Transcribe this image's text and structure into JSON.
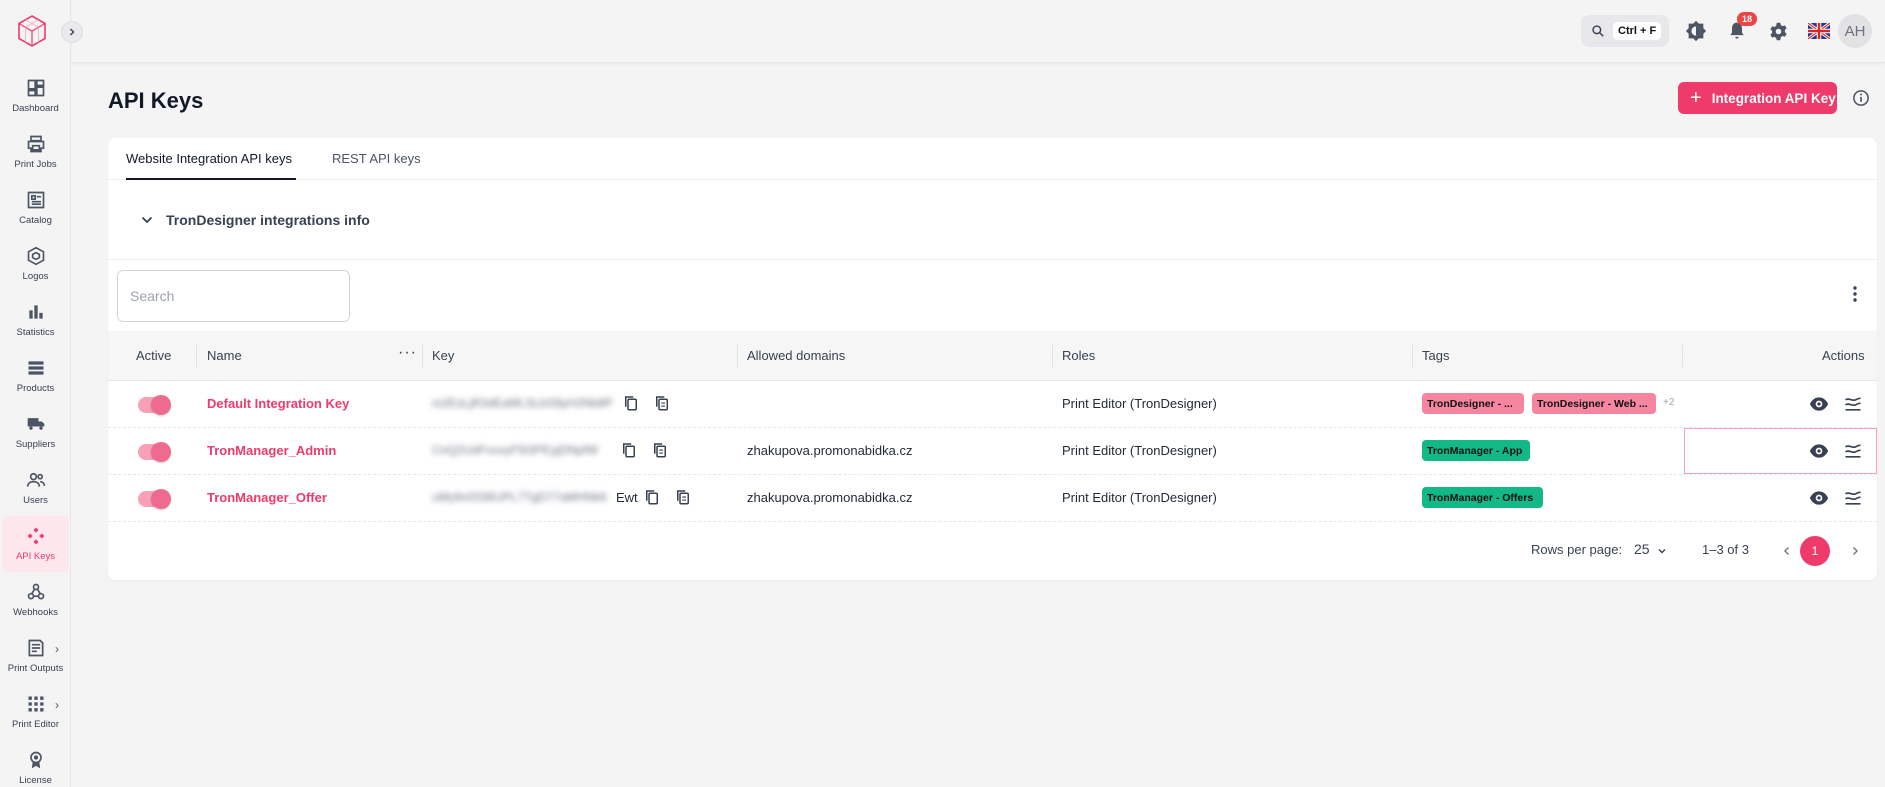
{
  "topbar": {
    "search_shortcut": "Ctrl + F",
    "notification_count": "18",
    "avatar_initials": "AH"
  },
  "sidebar": {
    "items": [
      {
        "label": "Dashboard",
        "icon": "dashboard-icon"
      },
      {
        "label": "Print Jobs",
        "icon": "printer-icon"
      },
      {
        "label": "Catalog",
        "icon": "catalog-icon"
      },
      {
        "label": "Logos",
        "icon": "logos-icon"
      },
      {
        "label": "Statistics",
        "icon": "bar-chart-icon"
      },
      {
        "label": "Products",
        "icon": "products-icon"
      },
      {
        "label": "Suppliers",
        "icon": "truck-icon"
      },
      {
        "label": "Users",
        "icon": "users-icon"
      },
      {
        "label": "API Keys",
        "icon": "api-keys-icon",
        "active": true
      },
      {
        "label": "Webhooks",
        "icon": "webhook-icon"
      },
      {
        "label": "Print Outputs",
        "icon": "print-outputs-icon"
      },
      {
        "label": "Print Editor",
        "icon": "grid-icon"
      },
      {
        "label": "License",
        "icon": "license-icon"
      }
    ]
  },
  "page": {
    "title": "API Keys",
    "add_button_label": "Integration API Key"
  },
  "tabs": [
    {
      "label": "Website Integration API keys",
      "active": true
    },
    {
      "label": "REST API keys",
      "active": false
    }
  ],
  "accordion": {
    "title": "TronDesigner integrations info"
  },
  "search": {
    "placeholder": "Search"
  },
  "table": {
    "columns": [
      "Active",
      "Name",
      "Key",
      "Allowed domains",
      "Roles",
      "Tags",
      "Actions"
    ],
    "rows": [
      {
        "active": true,
        "name": "Default Integration Key",
        "key": "m2EsLjR3dEaMLSLbS9yH2Nb8P",
        "domain": "",
        "role": "Print Editor (TronDesigner)",
        "tags": [
          "TronDesigner - ...",
          "TronDesigner - Web ..."
        ],
        "more_tags": "+2"
      },
      {
        "active": true,
        "name": "TronManager_Admin",
        "key": "CnQ2UdFvuvyF5t3PEyjDNpfW",
        "domain": "zhakupova.promonabidka.cz",
        "role": "Print Editor (TronDesigner)",
        "tags": [
          "TronManager - App"
        ],
        "more_tags": ""
      },
      {
        "active": true,
        "name": "TronManager_Offer",
        "key": "uMy9v0336UPL7TgD77aMHNk6",
        "key_suffix": "Ewt",
        "domain": "zhakupova.promonabidka.cz",
        "role": "Print Editor (TronDesigner)",
        "tags": [
          "TronManager - Offers"
        ],
        "more_tags": ""
      }
    ]
  },
  "pagination": {
    "rows_per_page_label": "Rows per page:",
    "rows_per_page": "25",
    "range": "1–3 of 3",
    "current_page": "1"
  },
  "colors": {
    "accent": "#ef3b6b",
    "tag_pink": "#f6869f",
    "tag_green": "#12b886"
  }
}
